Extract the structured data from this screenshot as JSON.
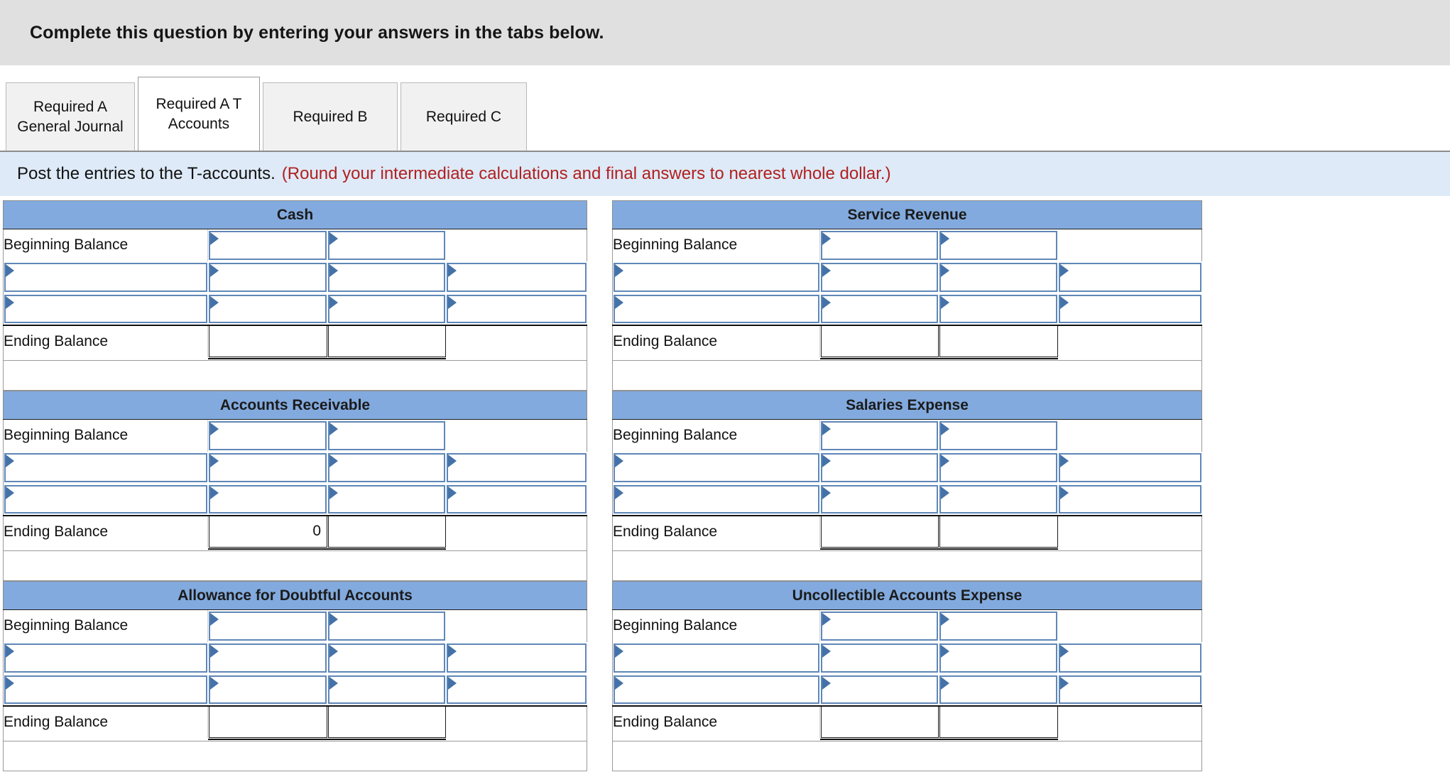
{
  "banner": {
    "text": "Complete this question by entering your answers in the tabs below."
  },
  "tabs": [
    {
      "id": "required-a-general-journal",
      "label": "Required A General Journal",
      "active": false
    },
    {
      "id": "required-a-t-accounts",
      "label": "Required A T Accounts",
      "active": true
    },
    {
      "id": "required-b",
      "label": "Required B",
      "active": false
    },
    {
      "id": "required-c",
      "label": "Required C",
      "active": false
    }
  ],
  "instruction": {
    "main": "Post the entries to the T-accounts.",
    "note": "(Round your intermediate calculations and final answers to nearest whole dollar.)"
  },
  "labels": {
    "beginning_balance": "Beginning Balance",
    "ending_balance": "Ending Balance"
  },
  "colors": {
    "account_header_blue": "#82aade",
    "instruction_bar_blue": "#deeaf7",
    "banner_gray": "#e0e0e0",
    "note_red": "#b12020",
    "input_border_blue": "#5f87b8",
    "marker_blue": "#4472a8"
  },
  "accounts": {
    "left": [
      {
        "name": "Cash",
        "beginning": {
          "debit": "",
          "credit": ""
        },
        "entries": [
          {
            "label": "",
            "debit": "",
            "credit": "",
            "extra": ""
          },
          {
            "label": "",
            "debit": "",
            "credit": "",
            "extra": ""
          }
        ],
        "ending": {
          "debit": "",
          "credit": ""
        }
      },
      {
        "name": "Accounts Receivable",
        "beginning": {
          "debit": "",
          "credit": ""
        },
        "entries": [
          {
            "label": "",
            "debit": "",
            "credit": "",
            "extra": ""
          },
          {
            "label": "",
            "debit": "",
            "credit": "",
            "extra": ""
          }
        ],
        "ending": {
          "debit": "0",
          "credit": ""
        }
      },
      {
        "name": "Allowance for Doubtful Accounts",
        "beginning": {
          "debit": "",
          "credit": ""
        },
        "entries": [
          {
            "label": "",
            "debit": "",
            "credit": "",
            "extra": ""
          },
          {
            "label": "",
            "debit": "",
            "credit": "",
            "extra": ""
          }
        ],
        "ending": {
          "debit": "",
          "credit": ""
        }
      }
    ],
    "right": [
      {
        "name": "Service Revenue",
        "beginning": {
          "debit": "",
          "credit": ""
        },
        "entries": [
          {
            "label": "",
            "debit": "",
            "credit": "",
            "extra": ""
          },
          {
            "label": "",
            "debit": "",
            "credit": "",
            "extra": ""
          }
        ],
        "ending": {
          "debit": "",
          "credit": ""
        }
      },
      {
        "name": "Salaries Expense",
        "beginning": {
          "debit": "",
          "credit": ""
        },
        "entries": [
          {
            "label": "",
            "debit": "",
            "credit": "",
            "extra": ""
          },
          {
            "label": "",
            "debit": "",
            "credit": "",
            "extra": ""
          }
        ],
        "ending": {
          "debit": "",
          "credit": ""
        }
      },
      {
        "name": "Uncollectible Accounts Expense",
        "beginning": {
          "debit": "",
          "credit": ""
        },
        "entries": [
          {
            "label": "",
            "debit": "",
            "credit": "",
            "extra": ""
          },
          {
            "label": "",
            "debit": "",
            "credit": "",
            "extra": ""
          }
        ],
        "ending": {
          "debit": "",
          "credit": ""
        }
      }
    ]
  }
}
